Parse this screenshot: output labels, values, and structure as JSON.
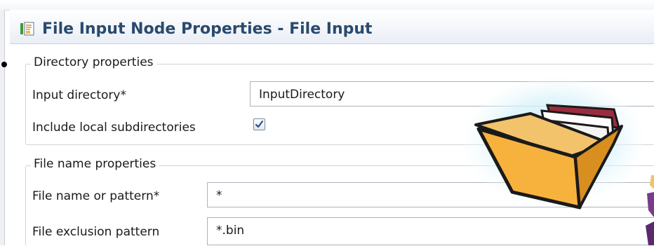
{
  "header": {
    "title": "File Input Node Properties - File Input",
    "icon": "properties-icon"
  },
  "directory_group": {
    "legend": "Directory properties",
    "input_directory_label": "Input directory*",
    "input_directory_value": "InputDirectory",
    "include_subdirs_label": "Include local subdirectories",
    "include_subdirs_checked": true
  },
  "file_name_group": {
    "legend": "File name properties",
    "pattern_label": "File name or pattern*",
    "pattern_value": "*",
    "exclusion_label": "File exclusion pattern",
    "exclusion_value": "*.bin"
  },
  "overlay": {
    "icon": "open-folder-icon"
  },
  "colors": {
    "title": "#2a4a6e",
    "folder": "#f7b23e",
    "glow": "#bfe9f7"
  }
}
